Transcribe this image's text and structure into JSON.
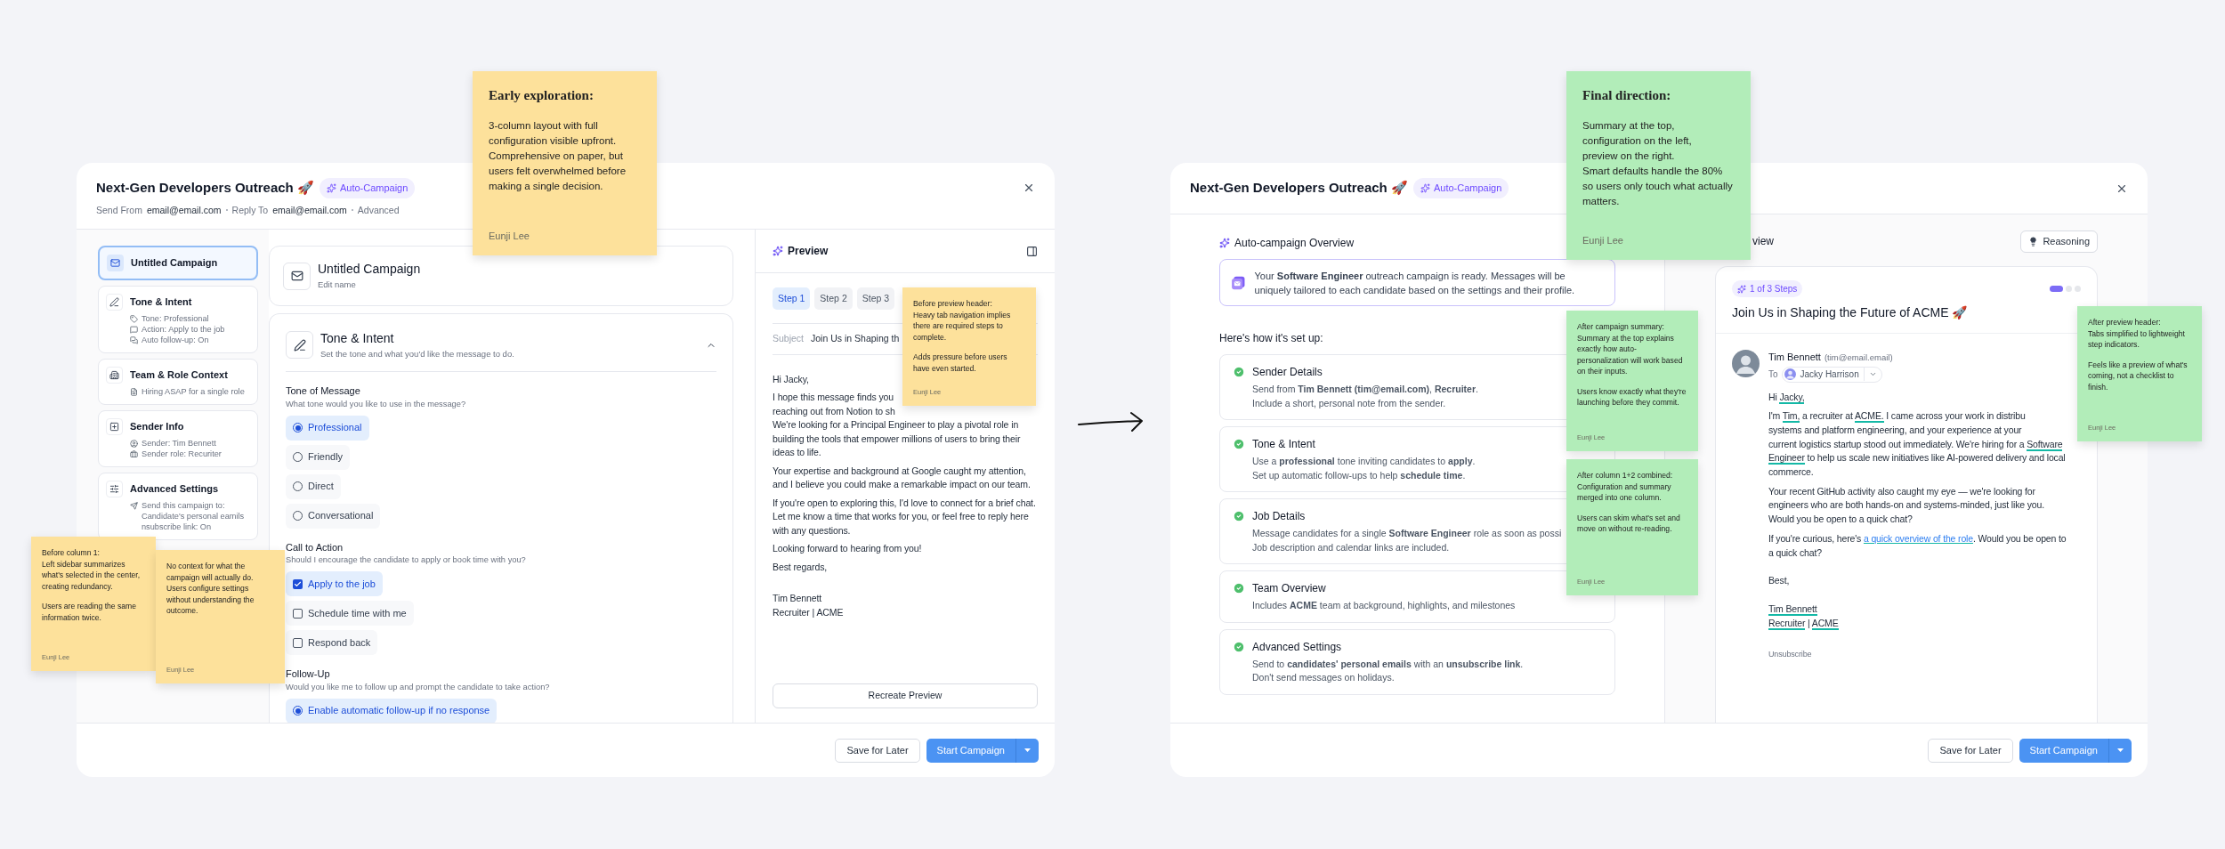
{
  "notes": [
    {
      "kind": "large",
      "color": "#fde19b",
      "title": "Early exploration:",
      "body": [
        "3-column layout with full configuration visible upfront. Comprehensive on paper, but users felt overwhelmed before making a single decision."
      ],
      "author": "Eunji Lee"
    },
    {
      "kind": "small",
      "color": "#fde19b",
      "body": [
        "Before column 1:\nLeft sidebar summarizes what's selected in the center, creating redundancy.",
        "Users are reading the same information twice."
      ],
      "author": "Eunji Lee"
    },
    {
      "kind": "small",
      "color": "#fde19b",
      "body": [
        "No context for what the campaign will actually do. Users configure settings without understanding the outcome."
      ],
      "author": "Eunji Lee"
    },
    {
      "kind": "small",
      "color": "#fde19b",
      "body": [
        "Before preview header:\nHeavy tab navigation implies there are required steps to complete.",
        "Adds pressure before users have even started."
      ],
      "author": "Eunji Lee"
    },
    {
      "kind": "large",
      "color": "#b2edb9",
      "title": "Final direction:",
      "body": [
        "Summary at the top,\nconfiguration on the left,\npreview on the right.\nSmart defaults handle the 80% so users only touch what actually matters."
      ],
      "author": "Eunji Lee"
    },
    {
      "kind": "small",
      "color": "#b2edb9",
      "body": [
        "After campaign summary:\nSummary at the top explains exactly how auto-personalization will work based on their inputs.",
        "Users know exactly what they're launching before they commit."
      ],
      "author": "Eunji Lee"
    },
    {
      "kind": "small",
      "color": "#b2edb9",
      "body": [
        "After column 1+2 combined:\nConfiguration and summary merged into one column.",
        "Users can skim what's set and move on without re-reading."
      ],
      "author": "Eunji Lee"
    },
    {
      "kind": "small",
      "color": "#b2edb9",
      "body": [
        "After preview header:\nTabs simplified to lightweight step indicators.",
        "Feels like a preview of what's coming, not a checklist to finish."
      ],
      "author": "Eunji Lee"
    }
  ],
  "before": {
    "title": "Next-Gen Developers Outreach 🚀",
    "badge": "Auto-Campaign",
    "meta": [
      {
        "label": "Send From",
        "value": "email@email.com"
      },
      {
        "label": "Reply To",
        "value": "email@email.com"
      }
    ],
    "advanced": "Advanced",
    "sidebar": [
      {
        "title": "Untitled Campaign",
        "selected": true
      },
      {
        "title": "Tone & Intent",
        "selected": false,
        "details": [
          "Tone: Professional",
          "Action: Apply to the job",
          "Auto follow-up: On"
        ]
      },
      {
        "title": "Team & Role Context",
        "selected": false,
        "details": [
          "Hiring ASAP for a single role"
        ]
      },
      {
        "title": "Sender Info",
        "selected": false,
        "details": [
          "Sender: Tim Bennett",
          "Sender role: Recuriter"
        ]
      },
      {
        "title": "Advanced Settings",
        "selected": false,
        "details": [
          "Send this campaign to:",
          "Candidate's personal eamils",
          "nsubscribe link: On"
        ]
      }
    ],
    "campaign": {
      "title": "Untitled Campaign",
      "subtitle": "Edit name"
    },
    "section": {
      "title": "Tone & Intent",
      "subtitle": "Set the tone and what you'd like the message to do.",
      "expanded": true,
      "groups": [
        {
          "kind": "radio",
          "label": "Tone of Message",
          "hint": "What tone would you like to use in the message?",
          "options": [
            {
              "label": "Professional",
              "selected": true
            },
            {
              "label": "Friendly",
              "selected": false
            },
            {
              "label": "Direct",
              "selected": false
            },
            {
              "label": "Conversational",
              "selected": false
            }
          ]
        },
        {
          "kind": "checkbox",
          "label": "Call to Action",
          "hint": "Should I encourage the candidate to apply or book time with you?",
          "options": [
            {
              "label": "Apply to the job",
              "checked": true
            },
            {
              "label": "Schedule time with me",
              "checked": false
            },
            {
              "label": "Respond back",
              "checked": false
            }
          ]
        },
        {
          "kind": "radio",
          "label": "Follow-Up",
          "hint": "Would you like me to follow up and prompt the candidate to take action?",
          "options": [
            {
              "label": "Enable automatic follow-up if no response",
              "selected": true
            }
          ]
        }
      ]
    },
    "preview": {
      "title": "Preview",
      "steps": [
        {
          "label": "Step 1",
          "selected": true
        },
        {
          "label": "Step 2",
          "selected": false
        },
        {
          "label": "Step 3",
          "selected": false
        }
      ],
      "subject_label": "Subject",
      "subject": "Join Us in Shaping th",
      "greeting": "Hi Jacky,",
      "lines": [
        "I hope this message finds you",
        "reaching out from Notion to sh",
        "We're looking for a Principal Engineer to play a pivotal role in building the tools that empower millions of users to bring their ideas to life."
      ],
      "paragraphs": [
        "Your expertise and background at Google caught my attention, and I believe you could make a remarkable impact on our team.",
        "If you're open to exploring this, I'd love to connect for a brief chat. Let me know a time that works for you, or feel free to reply here with any questions.",
        "Looking forward to hearing from you!",
        "Best regards,"
      ],
      "signature": [
        "Tim Bennett",
        "Recruiter | ACME"
      ],
      "action": "Recreate Preview"
    },
    "footer": {
      "secondary": "Save for Later",
      "primary": "Start Campaign"
    }
  },
  "after": {
    "title": "Next-Gen Developers Outreach 🚀",
    "badge": "Auto-Campaign",
    "overview": {
      "title": "Auto-campaign Overview",
      "summary": "Your **Software Engineer** outreach campaign is ready. Messages will be uniquely tailored to each candidate based on the settings and their profile."
    },
    "setup": {
      "title": "Here's how it's set up:",
      "items": [
        {
          "title": "Sender Details",
          "done": true,
          "lines": [
            "Send from **Tim Bennett (tim@email.com)**, **Recruiter**.",
            "Include a short, personal note from the sender."
          ]
        },
        {
          "title": "Tone & Intent",
          "done": true,
          "lines": [
            "Use a **professional** tone inviting candidates to **apply**.",
            "Set up automatic follow-ups to help **schedule time**."
          ]
        },
        {
          "title": "Job Details",
          "done": true,
          "lines": [
            "Message candidates for a single **Software Engineer** role as soon as possi",
            "Job description and calendar links are included."
          ]
        },
        {
          "title": "Team Overview",
          "done": true,
          "lines": [
            "Includes **ACME** team at background, highlights, and milestones"
          ]
        },
        {
          "title": "Advanced Settings",
          "done": true,
          "lines": [
            "Send to **candidates' personal emails** with an **unsubscribe link**.",
            "Don't send messages on holidays."
          ]
        }
      ]
    },
    "preview": {
      "title": "view",
      "reasoning": "Reasoning",
      "step_badge": "1 of 3 Steps",
      "steps": [
        {
          "selected": true
        },
        {
          "selected": false
        },
        {
          "selected": false
        }
      ],
      "subject": "Join Us in Shaping the Future of ACME 🚀",
      "sender": "Tim Bennett",
      "sender_email": "(tim@email.email)",
      "to_label": "To",
      "recipient": "Jacky Harrison",
      "greeting": [
        {
          "kind": "text",
          "text": "Hi "
        },
        {
          "kind": "field",
          "text": "Jacky,"
        }
      ],
      "lines": [
        [
          {
            "kind": "text",
            "text": "I'm "
          },
          {
            "kind": "field",
            "text": "Tim,"
          },
          {
            "kind": "text",
            "text": " a recruiter at "
          },
          {
            "kind": "field",
            "text": "ACME."
          },
          {
            "kind": "text",
            "text": " I came across your work in distribu"
          }
        ],
        [
          {
            "kind": "text",
            "text": "systems and platform engineering, and your experience at your"
          }
        ],
        [
          {
            "kind": "text",
            "text": "current logistics startup stood out immediately. We're hiring for a "
          },
          {
            "kind": "field",
            "text": "Software Engineer"
          },
          {
            "kind": "text",
            "text": " to help us scale new initiatives like AI-powered delivery and local commerce."
          }
        ]
      ],
      "paragraphs": [
        [
          {
            "kind": "text",
            "text": "Your recent GitHub activity also caught my eye — we're looking for engineers who are both hands-on and systems-minded, just like you. Would you be open to a quick chat?"
          }
        ],
        [
          {
            "kind": "text",
            "text": "If you're curious, here's "
          },
          {
            "kind": "link",
            "text": "a quick overview of the role"
          },
          {
            "kind": "text",
            "text": ". Would you be open to a quick chat?"
          }
        ]
      ],
      "closing": "Best,",
      "signature": [
        [
          {
            "kind": "field",
            "text": "Tim Bennett"
          }
        ],
        [
          {
            "kind": "field",
            "text": "Recruiter"
          },
          {
            "kind": "text",
            "text": " | "
          },
          {
            "kind": "field",
            "text": "ACME"
          }
        ]
      ],
      "unsubscribe": "Unsubscribe"
    },
    "footer": {
      "secondary": "Save for Later",
      "primary": "Start Campaign"
    }
  }
}
